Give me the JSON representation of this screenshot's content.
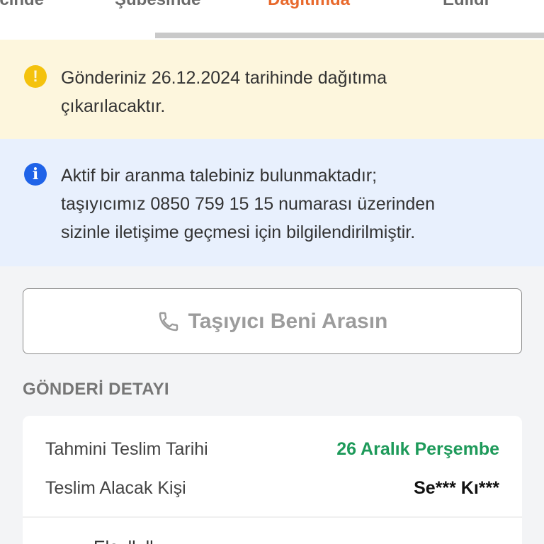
{
  "status_tabs": [
    {
      "label": "ecinde"
    },
    {
      "label": "Şubesinde"
    },
    {
      "label": "Dağıtımda"
    },
    {
      "label": "Edildi"
    }
  ],
  "progress": {
    "fraction": 0.285
  },
  "colors": {
    "active_tab": "#e8692c",
    "warning_bg": "#fdf6dd",
    "warning_icon": "#f4c20d",
    "info_bg": "#e8f0fd",
    "info_icon": "#1f63e8",
    "delivery_date": "#1e9a5a"
  },
  "notices": {
    "warning": {
      "icon": "exclamation-icon",
      "line1": "Gönderiniz 26.12.2024 tarihinde dağıtıma",
      "line2": "çıkarılacaktır."
    },
    "info": {
      "icon": "info-icon",
      "line1": "Aktif bir aranma talebiniz bulunmaktadır;",
      "line2": "taşıyıcımız 0850 759 15 15 numarası üzerinden",
      "line3": "sizinle iletişime geçmesi için bilgilendirilmiştir."
    }
  },
  "call_button": {
    "icon": "phone-icon",
    "label": "Taşıyıcı Beni Arasın"
  },
  "details": {
    "title": "GÖNDERİ DETAYI",
    "rows": [
      {
        "label": "Tahmini Teslim Tarihi",
        "value": "26 Aralık Perşembe"
      },
      {
        "label": "Teslim Alacak Kişi",
        "value": "Se*** Kı***"
      }
    ],
    "next_row_partial": "Elç..ll..ll.."
  }
}
